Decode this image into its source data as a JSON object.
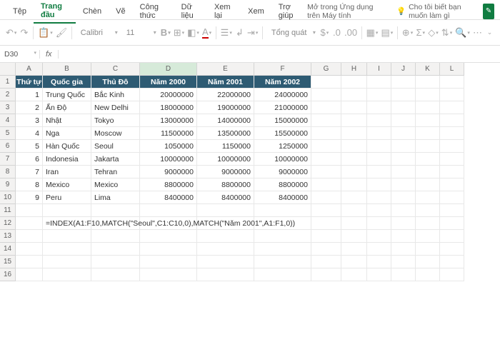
{
  "tabs": [
    "Tệp",
    "Trang đầu",
    "Chèn",
    "Vẽ",
    "Công thức",
    "Dữ liệu",
    "Xem lại",
    "Xem",
    "Trợ giúp"
  ],
  "activeTab": 1,
  "openDesktop": "Mở trong Ứng dụng trên Máy tính",
  "tellMe": "Cho tôi biết bạn muốn làm gì",
  "font": "Calibri",
  "fontSize": "11",
  "numFormat": "Tổng quát",
  "nameBox": "D30",
  "fxLabel": "fx",
  "formulaBar": "",
  "cols": [
    "A",
    "B",
    "C",
    "D",
    "E",
    "F",
    "G",
    "H",
    "I",
    "J",
    "K",
    "L"
  ],
  "headerRow": [
    "Thứ tự",
    "Quốc gia",
    "Thủ Đô",
    "Năm 2000",
    "Năm 2001",
    "Năm 2002"
  ],
  "rows": [
    {
      "n": "1",
      "country": "Trung Quốc",
      "cap": "Bắc Kinh",
      "y0": "20000000",
      "y1": "22000000",
      "y2": "24000000"
    },
    {
      "n": "2",
      "country": "Ấn Độ",
      "cap": "New Delhi",
      "y0": "18000000",
      "y1": "19000000",
      "y2": "21000000"
    },
    {
      "n": "3",
      "country": "Nhật",
      "cap": "Tokyo",
      "y0": "13000000",
      "y1": "14000000",
      "y2": "15000000"
    },
    {
      "n": "4",
      "country": "Nga",
      "cap": "Moscow",
      "y0": "11500000",
      "y1": "13500000",
      "y2": "15500000"
    },
    {
      "n": "5",
      "country": "Hàn Quốc",
      "cap": "Seoul",
      "y0": "1050000",
      "y1": "1150000",
      "y2": "1250000"
    },
    {
      "n": "6",
      "country": "Indonesia",
      "cap": "Jakarta",
      "y0": "10000000",
      "y1": "10000000",
      "y2": "10000000"
    },
    {
      "n": "7",
      "country": "Iran",
      "cap": "Tehran",
      "y0": "9000000",
      "y1": "9000000",
      "y2": "9000000"
    },
    {
      "n": "8",
      "country": "Mexico",
      "cap": "Mexico",
      "y0": "8800000",
      "y1": "8800000",
      "y2": "8800000"
    },
    {
      "n": "9",
      "country": "Peru",
      "cap": "Lima",
      "y0": "8400000",
      "y1": "8400000",
      "y2": "8400000"
    }
  ],
  "formulaCell": "=INDEX(A1:F10,MATCH(\"Seoul\",C1:C10,0),MATCH(\"Năm 2001\",A1:F1,0))",
  "rowCount": 16
}
